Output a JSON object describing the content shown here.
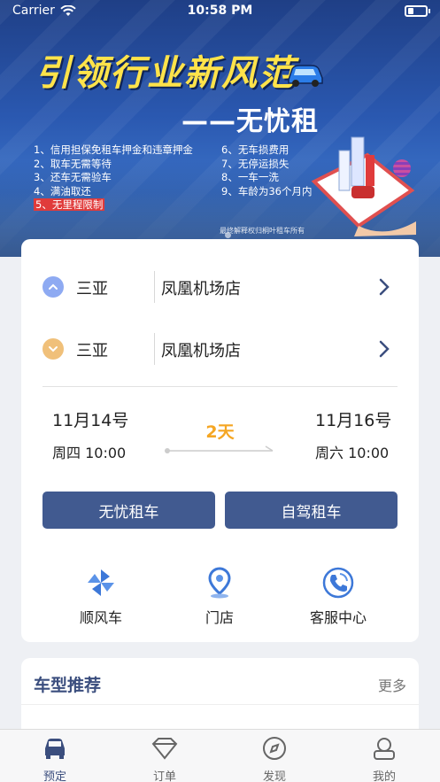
{
  "status_bar": {
    "carrier": "Carrier",
    "time": "10:58 PM"
  },
  "banner": {
    "headline": "引领行业新风范",
    "subline": "——无忧租",
    "features_left": [
      "1、信用担保免租车押金和违章押金",
      "2、取车无需等待",
      "3、还车无需验车",
      "4、满油取还",
      "5、无里程限制"
    ],
    "features_right": [
      "6、无车损费用",
      "7、无停运损失",
      "8、一车一洗",
      "9、车龄为36个月内"
    ],
    "fine_print": "最终解释权归桐叶租车所有"
  },
  "pickup": {
    "city": "三亚",
    "store": "凤凰机场店"
  },
  "dropoff": {
    "city": "三亚",
    "store": "凤凰机场店"
  },
  "schedule": {
    "start_date": "11月14号",
    "start_time": "周四 10:00",
    "duration": "2天",
    "end_date": "11月16号",
    "end_time": "周六 10:00"
  },
  "buttons": {
    "worry_free": "无忧租车",
    "self_drive": "自驾租车"
  },
  "quick_links": [
    {
      "label": "顺风车",
      "icon": "pinwheel-icon"
    },
    {
      "label": "门店",
      "icon": "location-pin-icon"
    },
    {
      "label": "客服中心",
      "icon": "phone-icon"
    }
  ],
  "recommend": {
    "title": "车型推荐",
    "more": "更多"
  },
  "tabs": [
    {
      "label": "预定",
      "icon": "car-icon",
      "active": true
    },
    {
      "label": "订单",
      "icon": "diamond-icon",
      "active": false
    },
    {
      "label": "发现",
      "icon": "compass-icon",
      "active": false
    },
    {
      "label": "我的",
      "icon": "profile-icon",
      "active": false
    }
  ],
  "colors": {
    "primary": "#415a90",
    "accent": "#f5a623",
    "pickup_circle": "#8eaaf2",
    "dropoff_circle": "#f0c07a",
    "icon_blue": "#3d78d8"
  }
}
